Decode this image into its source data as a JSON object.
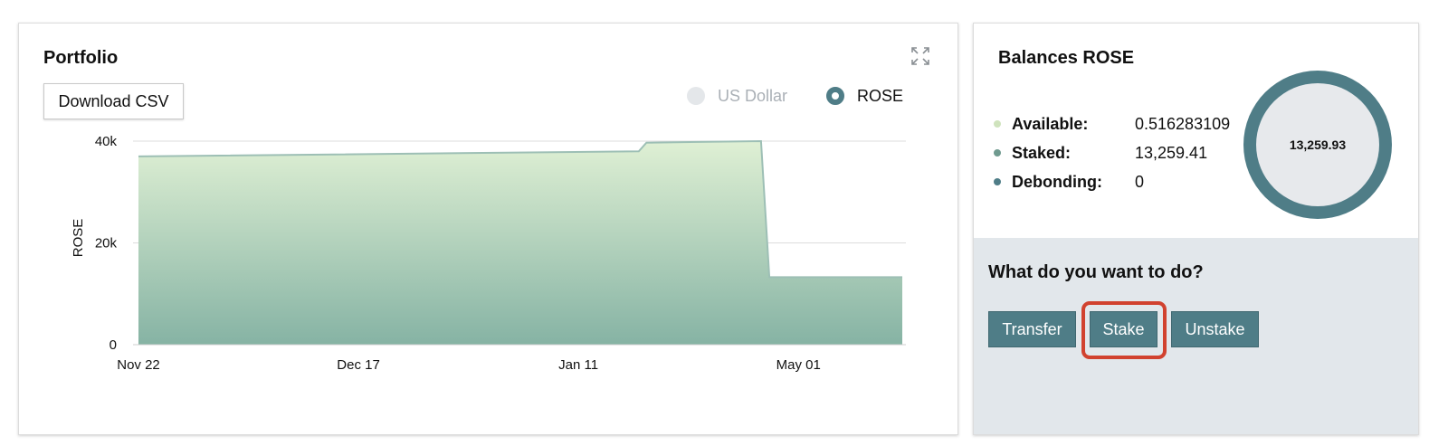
{
  "portfolio": {
    "title": "Portfolio",
    "download_label": "Download CSV",
    "legend": [
      {
        "label": "US Dollar",
        "active": false
      },
      {
        "label": "ROSE",
        "active": true
      }
    ],
    "expand_icon": "expand-icon"
  },
  "chart_data": {
    "type": "area",
    "ylabel": "ROSE",
    "xlabel": "",
    "y_ticks": [
      "0",
      "20k",
      "40k"
    ],
    "ylim": [
      0,
      40000
    ],
    "x_tick_labels": [
      "Nov 22",
      "Dec 17",
      "Jan 11",
      "May 01"
    ],
    "grid": true,
    "series": [
      {
        "name": "ROSE",
        "points": [
          {
            "x": 0.0,
            "y": 37000
          },
          {
            "x": 0.655,
            "y": 38000
          },
          {
            "x": 0.665,
            "y": 39700
          },
          {
            "x": 0.815,
            "y": 40000
          },
          {
            "x": 0.826,
            "y": 13259
          },
          {
            "x": 1.0,
            "y": 13259
          }
        ]
      }
    ],
    "colors": {
      "fill_top": "#dff0d4",
      "fill_bottom": "#86b3a4",
      "line": "#9dbfb5"
    }
  },
  "balances": {
    "title": "Balances ROSE",
    "rows": [
      {
        "label": "Available:",
        "value": "0.516283109",
        "color": "#cfe3bd"
      },
      {
        "label": "Staked:",
        "value": "13,259.41",
        "color": "#6f9a8f"
      },
      {
        "label": "Debonding:",
        "value": "0",
        "color": "#4f7d87"
      }
    ],
    "total": "13,259.93"
  },
  "actions": {
    "title": "What do you want to do?",
    "transfer_label": "Transfer",
    "stake_label": "Stake",
    "unstake_label": "Unstake"
  },
  "colors": {
    "accent": "#4f7d87",
    "highlight": "#d1422f",
    "panel_bg": "#e2e7eb"
  }
}
